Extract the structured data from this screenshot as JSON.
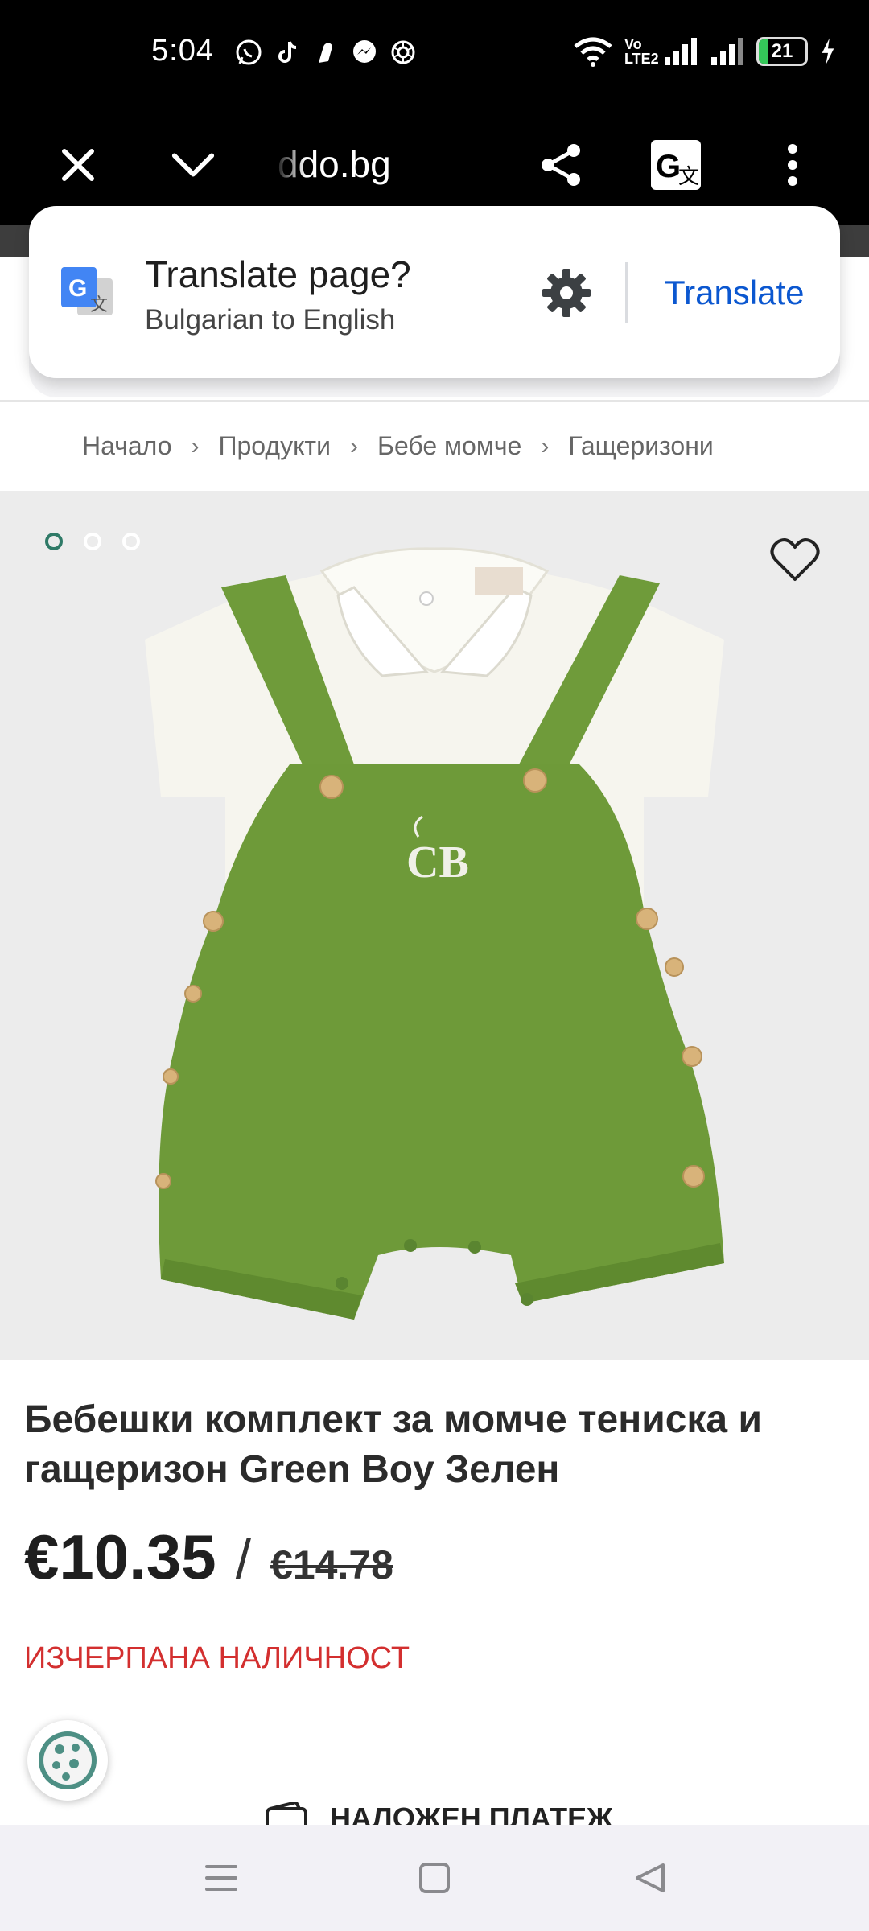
{
  "status_bar": {
    "time": "5:04",
    "app_icons": [
      "whatsapp-icon",
      "tiktok-icon",
      "app-icon",
      "messenger-icon",
      "chatgpt-icon"
    ],
    "network": "Vo LTE2",
    "battery": "21",
    "battery_level": 0.21,
    "battery_color": "#34c759"
  },
  "browser": {
    "url": "ddo.bg"
  },
  "translate_bar": {
    "title": "Translate page?",
    "subtitle": "Bulgarian to English",
    "action": "Translate",
    "action_color": "#0b57d0"
  },
  "breadcrumb": {
    "items": [
      "Начало",
      "Продукти",
      "Бебе момче",
      "Гащеризони"
    ],
    "separator": "›"
  },
  "product": {
    "title": "Бебешки комплект за момче тениска и гащеризон Green Boy Зелен",
    "price_new": "€10.35",
    "price_separator": "/",
    "price_old": "€14.78",
    "stock_status": "ИЗЧЕРПАНА НАЛИЧНОСТ",
    "stock_color": "#d32f2f",
    "image_count": 3,
    "active_image": 1
  },
  "payment": {
    "label": "НАЛОЖЕН ПЛАТЕЖ"
  }
}
